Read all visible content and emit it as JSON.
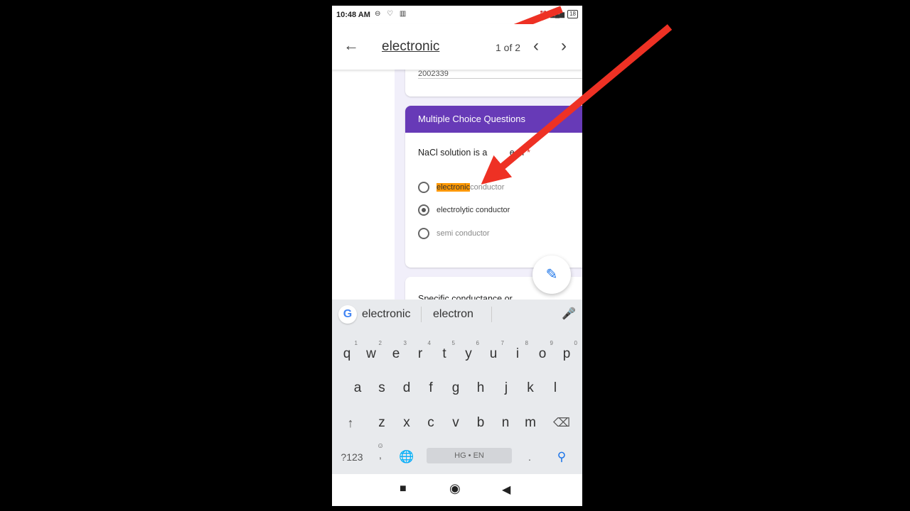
{
  "status_bar": {
    "time": "10:48 AM",
    "left_icons": "⊖ ♡ ▥",
    "battery": "18"
  },
  "find_bar": {
    "query": "electronic",
    "match_count": "1 of 2"
  },
  "form": {
    "partial_field": "2002339",
    "section_title": "Multiple Choice Questions",
    "question_1": "NaCl solution is a",
    "question_1_hidden_tail": "e of",
    "required_mark": "*",
    "options": [
      {
        "highlight": "electronic",
        "rest": " conductor",
        "selected": false
      },
      {
        "label": "electrolytic conductor",
        "selected": true
      },
      {
        "label": "semi conductor",
        "selected": false
      }
    ],
    "question_2": "Specific conductance or"
  },
  "keyboard": {
    "suggestions": [
      "electronic",
      "electron"
    ],
    "row1": [
      "q",
      "w",
      "e",
      "r",
      "t",
      "y",
      "u",
      "i",
      "o",
      "p"
    ],
    "row1_hints": [
      "1",
      "2",
      "3",
      "4",
      "5",
      "6",
      "7",
      "8",
      "9",
      "0"
    ],
    "row2": [
      "a",
      "s",
      "d",
      "f",
      "g",
      "h",
      "j",
      "k",
      "l"
    ],
    "row3": [
      "z",
      "x",
      "c",
      "v",
      "b",
      "n",
      "m"
    ],
    "symbols_key": "?123",
    "space_label": "HG • EN",
    "period_key": ".",
    "comma_key": ","
  },
  "colors": {
    "accent": "#673ab7",
    "highlight": "#ff9800",
    "arrow": "#ee3124"
  }
}
